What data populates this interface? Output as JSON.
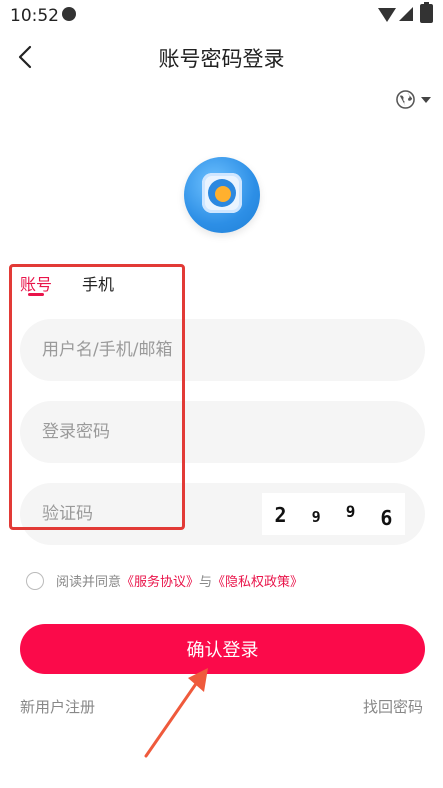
{
  "status_bar": {
    "time": "10:52"
  },
  "header": {
    "title": "账号密码登录"
  },
  "tabs": [
    {
      "label": "账号",
      "active": true
    },
    {
      "label": "手机",
      "active": false
    }
  ],
  "form": {
    "account_placeholder": "用户名/手机/邮箱",
    "password_placeholder": "登录密码",
    "captcha_placeholder": "验证码",
    "captcha_digits": [
      "2",
      "9",
      "9",
      "6"
    ]
  },
  "agreement": {
    "prefix": "阅读并同意",
    "service_link": "《服务协议》",
    "conjunction": "与",
    "privacy_link": "《隐私权政策》"
  },
  "actions": {
    "submit_label": "确认登录",
    "register_label": "新用户注册",
    "forgot_label": "找回密码"
  },
  "colors": {
    "accent": "#fb0a4a",
    "annotation": "#e23a36"
  },
  "icons": [
    "back-icon",
    "globe-icon",
    "caret-down-icon",
    "app-logo"
  ]
}
